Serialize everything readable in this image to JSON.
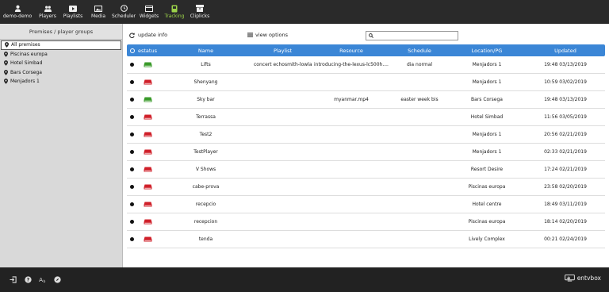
{
  "nav": {
    "user": "demo-demo",
    "items": [
      "Players",
      "Playlists",
      "Media",
      "Scheduler",
      "Widgets",
      "Tracking",
      "Cliplicks"
    ],
    "active": "Tracking",
    "active_color": "#9cd34a"
  },
  "left": {
    "header": "Premises / player groups",
    "items": [
      "All premises",
      "Piscinas europa",
      "Hotel Simbad",
      "Bars Corsega",
      "Menjadors 1"
    ]
  },
  "toolbar": {
    "update_label": "update info",
    "view_label": "view options",
    "search_value": ""
  },
  "table": {
    "headers": [
      "estatus",
      "Name",
      "Playlist",
      "Resource",
      "Schedule",
      "Location/PG",
      "Updated"
    ],
    "rows": [
      {
        "status": "green",
        "name": "Lifts",
        "playlist": "concert echosmith-lowland",
        "resource": "introducing-the-lexus-lc500h....",
        "schedule": "dia normal",
        "location": "Menjadors 1",
        "updated": "19:48 03/13/2019"
      },
      {
        "status": "red",
        "name": "Shenyang",
        "playlist": "",
        "resource": "",
        "schedule": "",
        "location": "Menjadors 1",
        "updated": "10:59 03/02/2019"
      },
      {
        "status": "green",
        "name": "Sky bar",
        "playlist": "",
        "resource": "myanmar.mp4",
        "schedule": "easter week bis",
        "location": "Bars Corsega",
        "updated": "19:48 03/13/2019"
      },
      {
        "status": "red",
        "name": "Terrassa",
        "playlist": "",
        "resource": "",
        "schedule": "",
        "location": "Hotel Simbad",
        "updated": "11:56 03/05/2019"
      },
      {
        "status": "red",
        "name": "Test2",
        "playlist": "",
        "resource": "",
        "schedule": "",
        "location": "Menjadors 1",
        "updated": "20:56 02/21/2019"
      },
      {
        "status": "red",
        "name": "TestPlayer",
        "playlist": "",
        "resource": "",
        "schedule": "",
        "location": "Menjadors 1",
        "updated": "02:33 02/21/2019"
      },
      {
        "status": "red",
        "name": "V Shows",
        "playlist": "",
        "resource": "",
        "schedule": "",
        "location": "Resort Desire",
        "updated": "17:24 02/21/2019"
      },
      {
        "status": "red",
        "name": "cabe-prova",
        "playlist": "",
        "resource": "",
        "schedule": "",
        "location": "Piscinas europa",
        "updated": "23:58 02/20/2019"
      },
      {
        "status": "red",
        "name": "recepcio",
        "playlist": "",
        "resource": "",
        "schedule": "",
        "location": "Hotel centre",
        "updated": "18:49 03/11/2019"
      },
      {
        "status": "red",
        "name": "recepcion",
        "playlist": "",
        "resource": "",
        "schedule": "",
        "location": "Piscinas europa",
        "updated": "18:14 02/20/2019"
      },
      {
        "status": "red",
        "name": "tenda",
        "playlist": "",
        "resource": "",
        "schedule": "",
        "location": "Lively Complex",
        "updated": "00:21 02/24/2019"
      }
    ]
  },
  "colors": {
    "header_blue": "#3b86d6",
    "status_green": "#3a9a2a",
    "status_red": "#d0202a"
  },
  "brand": "entvbox"
}
